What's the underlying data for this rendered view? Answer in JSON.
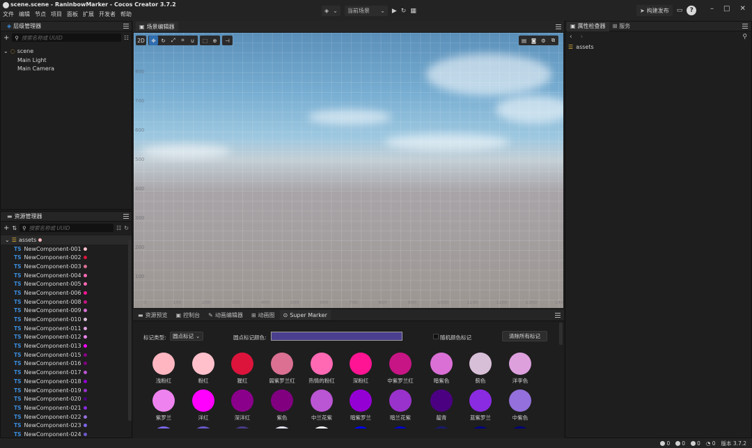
{
  "window": {
    "title": "scene.scene - RaninbowMarker - Cocos Creator 3.7.2",
    "menu": [
      "文件",
      "编辑",
      "节点",
      "项目",
      "面板",
      "扩展",
      "开发者",
      "帮助"
    ]
  },
  "toolbar": {
    "current_scene_label": "当前场景",
    "build_publish_label": "构建发布"
  },
  "hierarchy": {
    "title": "层级管理器",
    "search_placeholder": "搜索名称或 UUID",
    "nodes": [
      {
        "label": "scene"
      },
      {
        "label": "Main Light"
      },
      {
        "label": "Main Camera"
      }
    ]
  },
  "assets": {
    "title": "资源管理器",
    "search_placeholder": "搜索名称或 UUID",
    "root_label": "assets",
    "items": [
      {
        "label": "NewComponent-001",
        "color": "#ffc0cb"
      },
      {
        "label": "NewComponent-002",
        "color": "#dc143c"
      },
      {
        "label": "NewComponent-003",
        "color": "#db7093"
      },
      {
        "label": "NewComponent-004",
        "color": "#ff69b4"
      },
      {
        "label": "NewComponent-005",
        "color": "#ff69b4"
      },
      {
        "label": "NewComponent-006",
        "color": "#ff1493"
      },
      {
        "label": "NewComponent-008",
        "color": "#c71585"
      },
      {
        "label": "NewComponent-009",
        "color": "#da70d6"
      },
      {
        "label": "NewComponent-010",
        "color": "#d8bfd8"
      },
      {
        "label": "NewComponent-011",
        "color": "#dda0dd"
      },
      {
        "label": "NewComponent-012",
        "color": "#ee82ee"
      },
      {
        "label": "NewComponent-013",
        "color": "#ff00ff"
      },
      {
        "label": "NewComponent-015",
        "color": "#8b008b"
      },
      {
        "label": "NewComponent-016",
        "color": "#800080"
      },
      {
        "label": "NewComponent-017",
        "color": "#ba55d3"
      },
      {
        "label": "NewComponent-018",
        "color": "#9400d3"
      },
      {
        "label": "NewComponent-019",
        "color": "#9932cc"
      },
      {
        "label": "NewComponent-020",
        "color": "#4b0082"
      },
      {
        "label": "NewComponent-021",
        "color": "#8a2be2"
      },
      {
        "label": "NewComponent-022",
        "color": "#9370db"
      },
      {
        "label": "NewComponent-023",
        "color": "#7b68ee"
      },
      {
        "label": "NewComponent-024",
        "color": "#6a5acd"
      }
    ]
  },
  "scene_editor": {
    "title": "场景编辑器",
    "mode_2d_label": "2D",
    "y_ticks": [
      "800",
      "700",
      "600",
      "500",
      "400",
      "300",
      "200",
      "100"
    ],
    "x_ticks": [
      "0",
      "100",
      "200",
      "300",
      "400",
      "500",
      "600",
      "700",
      "800",
      "900",
      "1000",
      "1100",
      "1200",
      "1300",
      "1400"
    ]
  },
  "bottom_tabs": [
    "资源预览",
    "控制台",
    "动画编辑器",
    "动画图",
    "Super Marker"
  ],
  "super_marker": {
    "marker_type_label": "标记类型:",
    "marker_type_value": "圆点标记",
    "dot_color_label": "圆点标记颜色:",
    "dot_color": "#4a3f8f",
    "random_color_label": "随机颜色标记",
    "clear_all_label": "清除所有标记",
    "swatches": [
      {
        "name": "浅粉红",
        "color": "#ffb6c1"
      },
      {
        "name": "粉红",
        "color": "#ffc0cb"
      },
      {
        "name": "猩红",
        "color": "#dc143c"
      },
      {
        "name": "弱紫罗兰红",
        "color": "#db7093"
      },
      {
        "name": "热情的粉红",
        "color": "#ff69b4"
      },
      {
        "name": "深粉红",
        "color": "#ff1493"
      },
      {
        "name": "中紫罗兰红",
        "color": "#c71585"
      },
      {
        "name": "暗紫色",
        "color": "#da70d6"
      },
      {
        "name": "蓟色",
        "color": "#d8bfd8"
      },
      {
        "name": "洋李色",
        "color": "#dda0dd"
      },
      {
        "name": "紫罗兰",
        "color": "#ee82ee"
      },
      {
        "name": "洋红",
        "color": "#ff00ff"
      },
      {
        "name": "深洋红",
        "color": "#8b008b"
      },
      {
        "name": "紫色",
        "color": "#800080"
      },
      {
        "name": "中兰花紫",
        "color": "#ba55d3"
      },
      {
        "name": "暗紫罗兰",
        "color": "#9400d3"
      },
      {
        "name": "暗兰花紫",
        "color": "#9932cc"
      },
      {
        "name": "靛青",
        "color": "#4b0082"
      },
      {
        "name": "蓝紫罗兰",
        "color": "#8a2be2"
      },
      {
        "name": "中紫色",
        "color": "#9370db"
      }
    ],
    "partial_row_colors": [
      "#7b68ee",
      "#6a5acd",
      "#483d8b",
      "#e6e6fa",
      "#f8f8ff",
      "#0000ff",
      "#0000cd",
      "#191970",
      "#00008b",
      "#000080"
    ]
  },
  "inspector": {
    "tab_inspector": "属性检查器",
    "tab_service": "服务",
    "selected_label": "assets"
  },
  "status": {
    "info_count": "0",
    "warn_count": "0",
    "error_count": "0",
    "notify_count": "0",
    "version_label": "版本 3.7.2"
  }
}
